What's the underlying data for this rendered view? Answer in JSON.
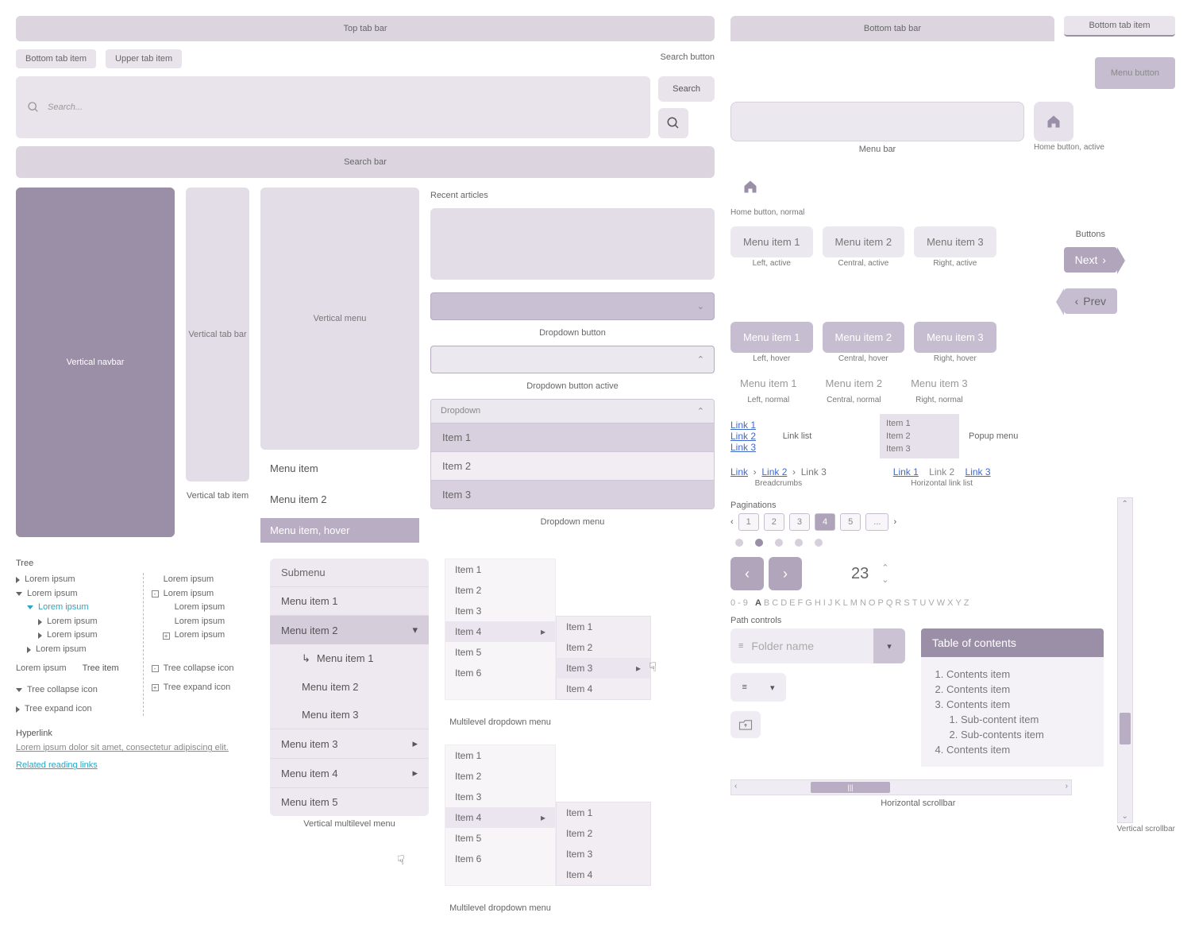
{
  "top_tab_bar": "Top tab bar",
  "bottom_tab_item": "Bottom tab item",
  "upper_tab_item": "Upper tab item",
  "search_button_label": "Search button",
  "search_placeholder": "Search...",
  "search_btn": "Search",
  "search_bar": "Search bar",
  "vertical_navbar": "Vertical navbar",
  "vertical_tab_bar": "Vertical tab bar",
  "vertical_tab_item": "Vertical tab item",
  "vertical_menu": "Vertical menu",
  "menu_item": "Menu item",
  "menu_item_2": "Menu item 2",
  "menu_item_hover": "Menu item, hover",
  "recent_articles": "Recent articles",
  "dropdown_button": "Dropdown button",
  "dropdown_button_active": "Dropdown button active",
  "dropdown_label": "Dropdown",
  "dropdown_items": [
    "Item 1",
    "Item 2",
    "Item 3"
  ],
  "dropdown_menu_label": "Dropdown menu",
  "ml_items": [
    "Item 1",
    "Item 2",
    "Item 3",
    "Item 4",
    "Item 5",
    "Item 6"
  ],
  "ml_sub": [
    "Item 1",
    "Item 2",
    "Item 3",
    "Item 4"
  ],
  "ml_label": "Multilevel dropdown menu",
  "vmulti_header": "Submenu",
  "vmulti_items": [
    "Menu item 1",
    "Menu item 2",
    "Menu item 3",
    "Menu item 4",
    "Menu item 5"
  ],
  "vmulti_sub": [
    "Menu item 1",
    "Menu item 2",
    "Menu item 3"
  ],
  "vmulti_label": "Vertical multilevel menu",
  "tree_label": "Tree",
  "tree_lorem": "Lorem ipsum",
  "tree_item": "Tree item",
  "tree_collapse": "Tree collapse icon",
  "tree_expand": "Tree expand icon",
  "hyperlink_label": "Hyperlink",
  "hyperlink_text": "Lorem ipsum dolor sit amet, consectetur adipiscing elit.",
  "related_links": "Related reading links",
  "bottom_tab_bar": "Bottom tab bar",
  "bottom_tab_item_r": "Bottom tab item",
  "menu_button": "Menu button",
  "menu_bar": "Menu bar",
  "home_active": "Home button, active",
  "home_normal": "Home button, normal",
  "menu_items_row": [
    "Menu item 1",
    "Menu item 2",
    "Menu item 3"
  ],
  "left_active": "Left, active",
  "central_active": "Central, active",
  "right_active": "Right, active",
  "left_hover": "Left, hover",
  "central_hover": "Central, hover",
  "right_hover": "Right, hover",
  "left_normal": "Left, normal",
  "central_normal": "Central, normal",
  "right_normal": "Right, normal",
  "link_list_items": [
    "Link 1",
    "Link 2",
    "Link 3"
  ],
  "link_list": "Link list",
  "popup_items": [
    "Item 1",
    "Item 2",
    "Item 3"
  ],
  "popup_menu": "Popup menu",
  "breadcrumb_items": [
    "Link",
    "Link 2",
    "Link 3"
  ],
  "breadcrumbs": "Breadcrumbs",
  "hlink_items": [
    "Link 1",
    "Link 2",
    "Link 3"
  ],
  "hlink_list": "Horizontal link list",
  "paginations": "Paginations",
  "pag_nums": [
    "1",
    "2",
    "3",
    "4",
    "5",
    "..."
  ],
  "spin_val": "23",
  "alpha_prefix": "0-9",
  "alpha": [
    "A",
    "B",
    "C",
    "D",
    "E",
    "F",
    "G",
    "H",
    "I",
    "J",
    "K",
    "L",
    "M",
    "N",
    "O",
    "P",
    "Q",
    "R",
    "S",
    "T",
    "U",
    "V",
    "W",
    "X",
    "Y",
    "Z"
  ],
  "path_controls": "Path controls",
  "folder_name": "Folder name",
  "toc_title": "Table of contents",
  "toc_items": [
    "Contents item",
    "Contents item",
    "Contents item",
    "Contents item"
  ],
  "toc_sub": [
    "Sub-content item",
    "Sub-contents item"
  ],
  "buttons_label": "Buttons",
  "next": "Next",
  "prev": "Prev",
  "hscroll_label": "Horizontal scrollbar",
  "vscroll_label": "Vertical scrollbar"
}
